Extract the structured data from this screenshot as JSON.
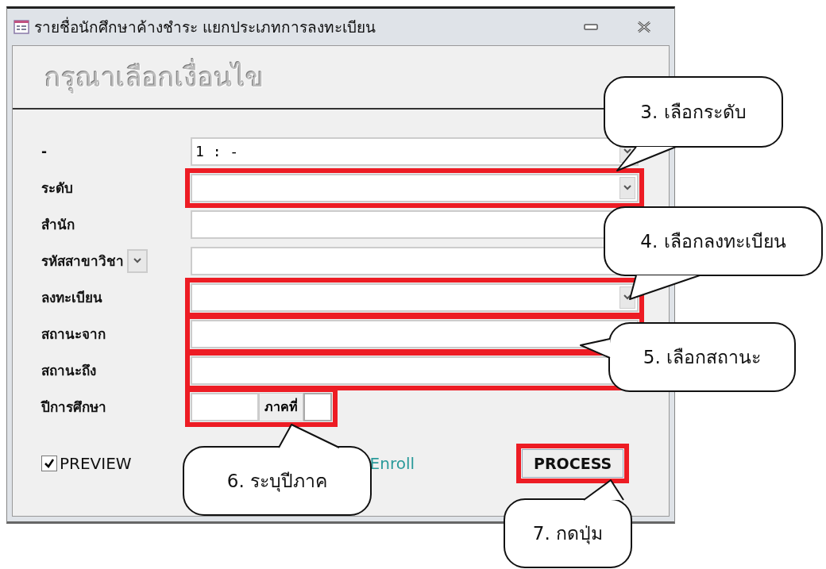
{
  "window": {
    "title": "รายชื่อนักศึกษาค้างชำระ แยกประเภทการลงทะเบียน"
  },
  "heading": "กรุณาเลือกเงื่อนไข",
  "fields": [
    {
      "label": "-",
      "kind": "combo",
      "value": "1 : -",
      "highlighted": false
    },
    {
      "label": "ระดับ",
      "kind": "combo",
      "highlighted": true
    },
    {
      "label": "สำนัก",
      "kind": "text",
      "highlighted": false
    },
    {
      "label": "รหัสสาขาวิชา",
      "kind": "label-combo",
      "highlighted": false
    },
    {
      "label": "ลงทะเบียน",
      "kind": "combo",
      "highlighted": true
    },
    {
      "label": "สถานะจาก",
      "kind": "text",
      "highlighted": true
    },
    {
      "label": "สถานะถึง",
      "kind": "text",
      "highlighted": true
    }
  ],
  "academic_year": {
    "label": "ปีการศึกษา",
    "term_label": "ภาคที่",
    "highlighted": true
  },
  "preview": {
    "label": "PREVIEW",
    "checked": true
  },
  "link": "Enroll",
  "process_button": {
    "label": "PROCESS",
    "highlighted": true
  },
  "callouts": [
    {
      "text": "3.  เลือกระดับ"
    },
    {
      "text": "4.  เลือกลงทะเบียน"
    },
    {
      "text": "5.  เลือกสถานะ"
    },
    {
      "text": "6.  ระบุปีภาค"
    },
    {
      "text": "7.  กดปุ่ม"
    }
  ]
}
